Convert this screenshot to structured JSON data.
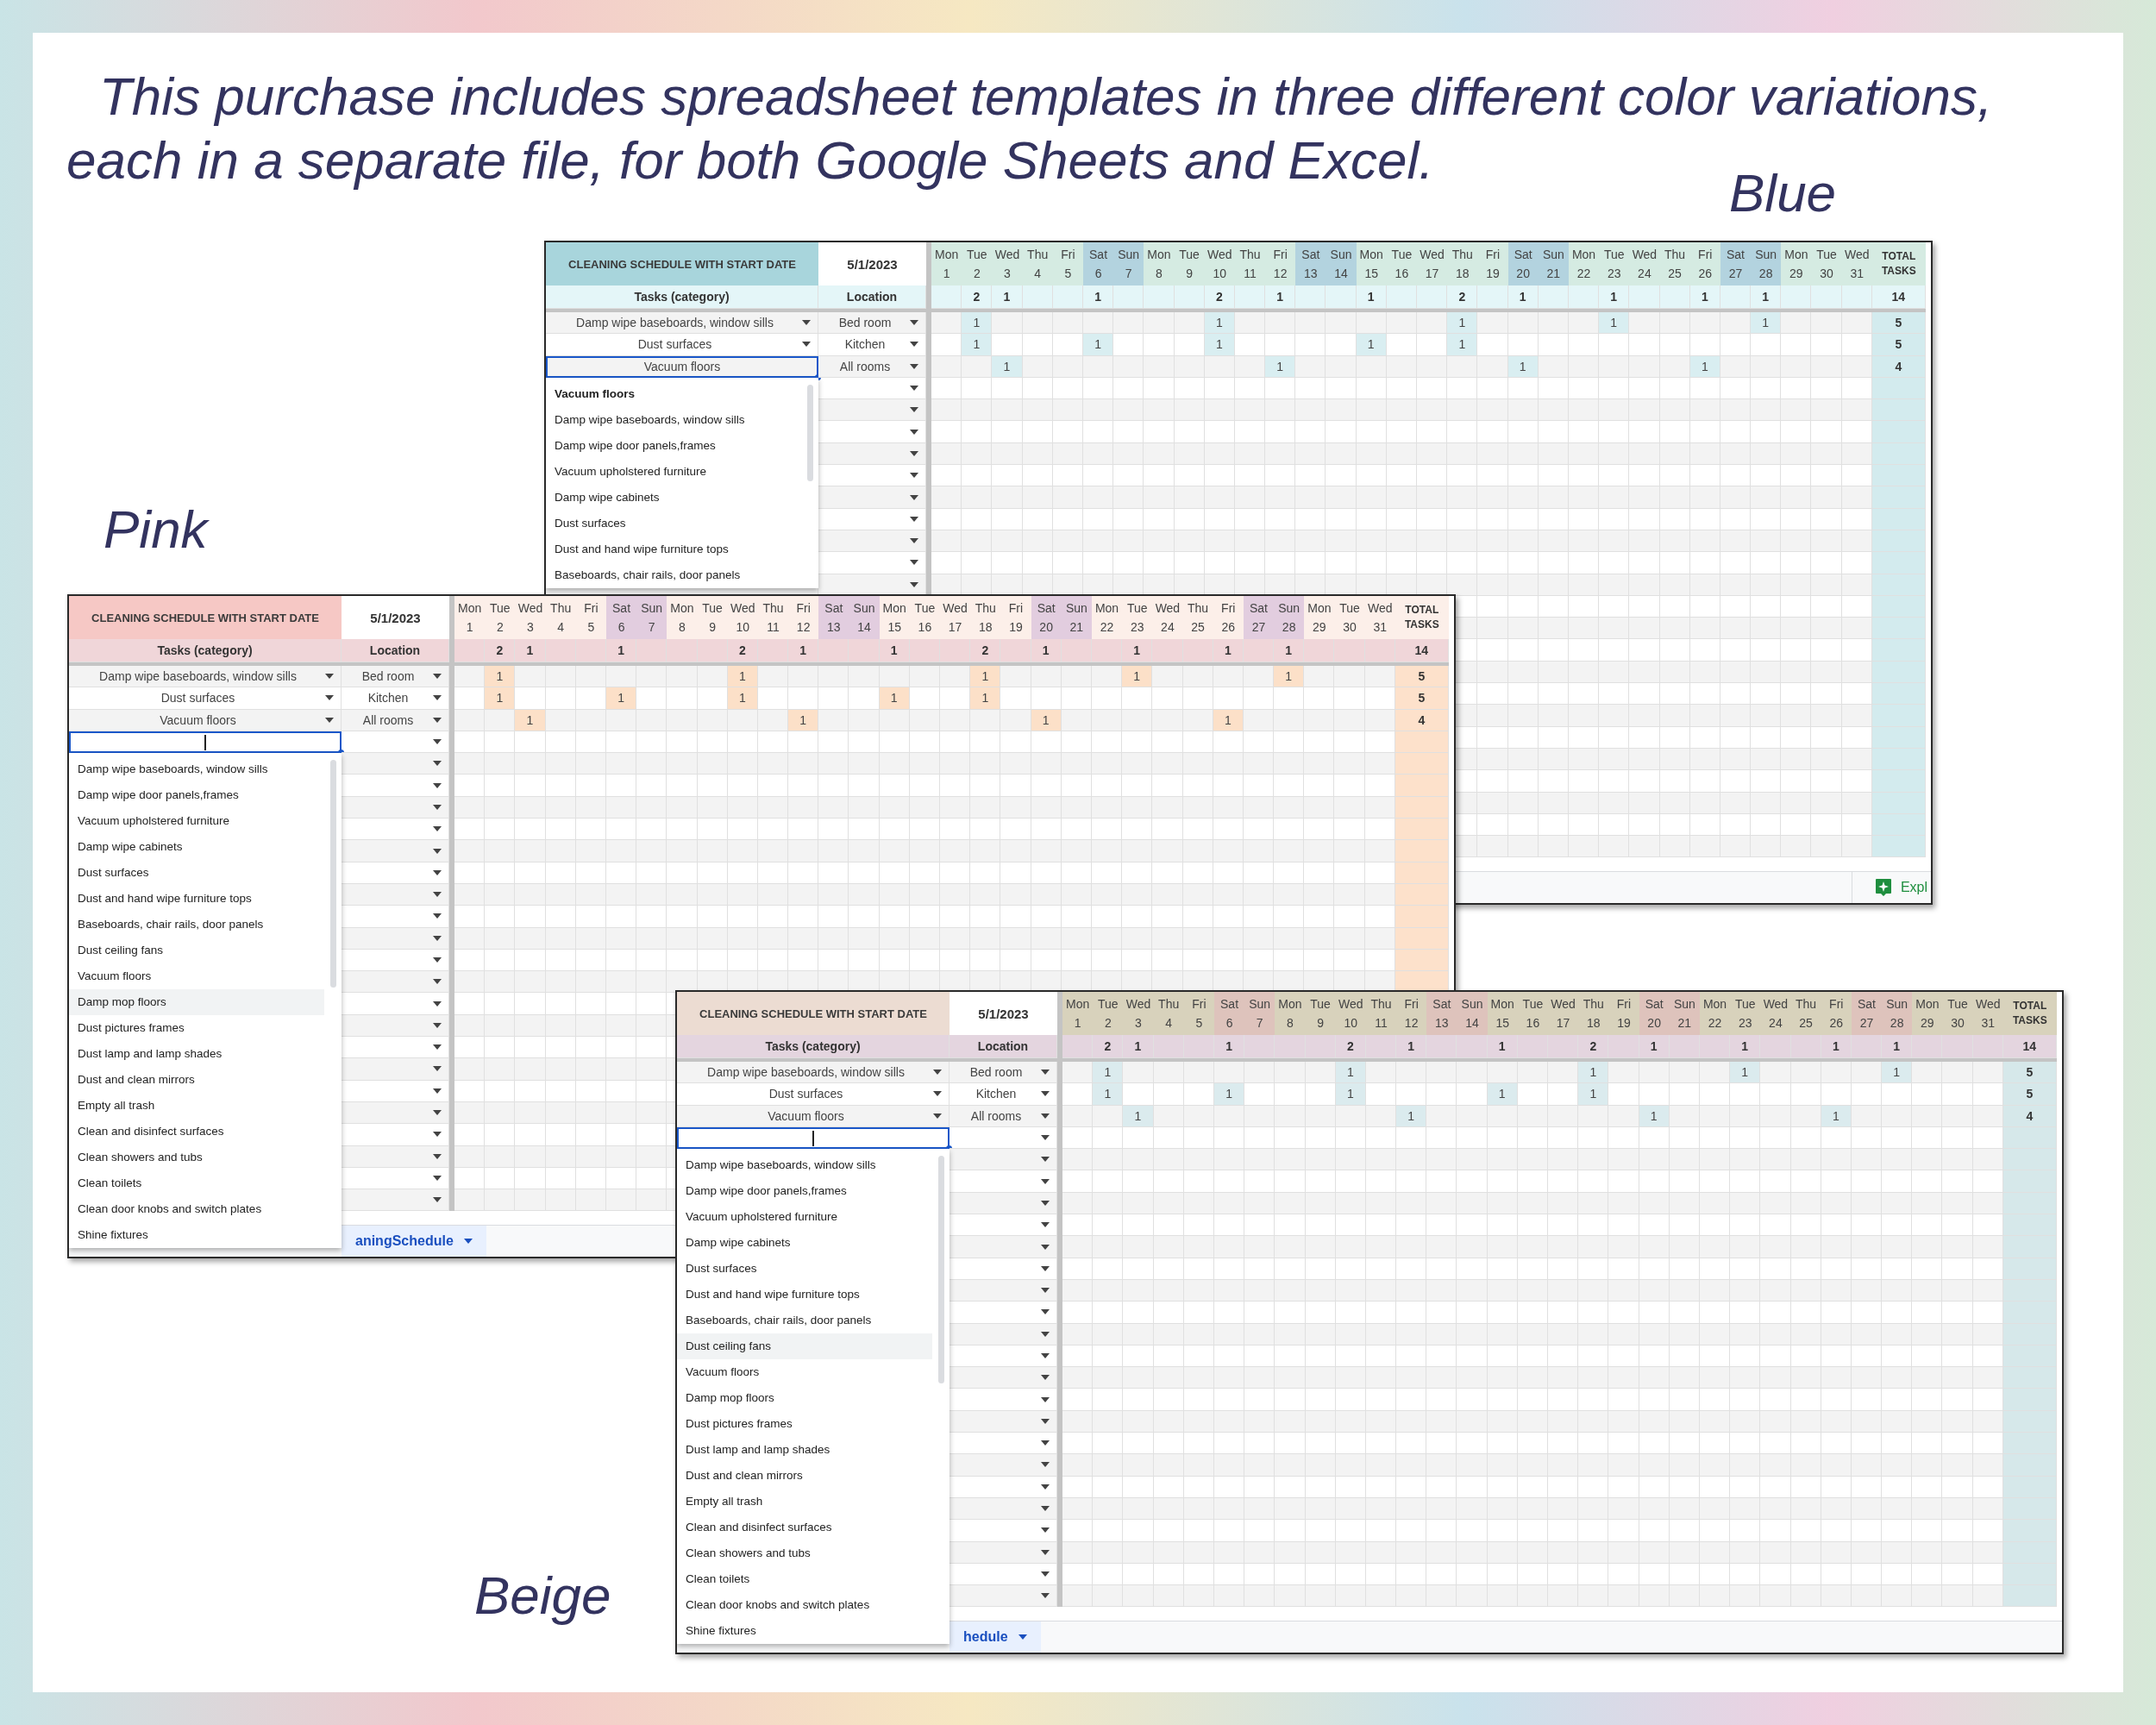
{
  "headline": "This purchase includes spreadsheet templates in three different color variations,\neach in a separate file, for both Google Sheets and Excel.",
  "sheets": [
    {
      "kind": "blue",
      "label": "Blue",
      "title": "CLEANING SCHEDULE WITH START DATE",
      "start_date": "5/1/2023",
      "task_header": "Tasks (category)",
      "location_header": "Location",
      "total_header": "TOTAL TASKS",
      "grand_total": "14",
      "days": [
        {
          "dow": "Mon",
          "date": "1",
          "weekend": false
        },
        {
          "dow": "Tue",
          "date": "2",
          "weekend": false,
          "total": "2"
        },
        {
          "dow": "Wed",
          "date": "3",
          "weekend": false,
          "total": "1"
        },
        {
          "dow": "Thu",
          "date": "4",
          "weekend": false
        },
        {
          "dow": "Fri",
          "date": "5",
          "weekend": false
        },
        {
          "dow": "Sat",
          "date": "6",
          "weekend": true,
          "total": "1"
        },
        {
          "dow": "Sun",
          "date": "7",
          "weekend": true
        },
        {
          "dow": "Mon",
          "date": "8",
          "weekend": false
        },
        {
          "dow": "Tue",
          "date": "9",
          "weekend": false
        },
        {
          "dow": "Wed",
          "date": "10",
          "weekend": false,
          "total": "2"
        },
        {
          "dow": "Thu",
          "date": "11",
          "weekend": false
        },
        {
          "dow": "Fri",
          "date": "12",
          "weekend": false,
          "total": "1"
        },
        {
          "dow": "Sat",
          "date": "13",
          "weekend": true
        },
        {
          "dow": "Sun",
          "date": "14",
          "weekend": true
        },
        {
          "dow": "Mon",
          "date": "15",
          "weekend": false,
          "total": "1"
        },
        {
          "dow": "Tue",
          "date": "16",
          "weekend": false
        },
        {
          "dow": "Wed",
          "date": "17",
          "weekend": false
        },
        {
          "dow": "Thu",
          "date": "18",
          "weekend": false,
          "total": "2"
        },
        {
          "dow": "Fri",
          "date": "19",
          "weekend": false
        },
        {
          "dow": "Sat",
          "date": "20",
          "weekend": true,
          "total": "1"
        },
        {
          "dow": "Sun",
          "date": "21",
          "weekend": true
        },
        {
          "dow": "Mon",
          "date": "22",
          "weekend": false
        },
        {
          "dow": "Tue",
          "date": "23",
          "weekend": false,
          "total": "1"
        },
        {
          "dow": "Wed",
          "date": "24",
          "weekend": false
        },
        {
          "dow": "Thu",
          "date": "25",
          "weekend": false
        },
        {
          "dow": "Fri",
          "date": "26",
          "weekend": false,
          "total": "1"
        },
        {
          "dow": "Sat",
          "date": "27",
          "weekend": true
        },
        {
          "dow": "Sun",
          "date": "28",
          "weekend": true,
          "total": "1"
        },
        {
          "dow": "Mon",
          "date": "29",
          "weekend": false
        },
        {
          "dow": "Tue",
          "date": "30",
          "weekend": false
        },
        {
          "dow": "Wed",
          "date": "31",
          "weekend": false
        }
      ],
      "rows": [
        {
          "task": "Damp wipe baseboards, window sills",
          "location": "Bed room",
          "total": "5",
          "active": false,
          "cells": [
            null,
            "1",
            null,
            null,
            null,
            null,
            null,
            null,
            null,
            "1",
            null,
            null,
            null,
            null,
            null,
            null,
            null,
            "1",
            null,
            null,
            null,
            null,
            "1",
            null,
            null,
            null,
            null,
            "1",
            null,
            null,
            null
          ]
        },
        {
          "task": "Dust surfaces",
          "location": "Kitchen",
          "total": "5",
          "active": false,
          "cells": [
            null,
            "1",
            null,
            null,
            null,
            "1",
            null,
            null,
            null,
            "1",
            null,
            null,
            null,
            null,
            "1",
            null,
            null,
            "1",
            null,
            null,
            null,
            null,
            null,
            null,
            null,
            null,
            null,
            null,
            null,
            null,
            null
          ]
        },
        {
          "task": "Vacuum floors",
          "location": "All rooms",
          "total": "4",
          "active": true,
          "cells": [
            null,
            null,
            "1",
            null,
            null,
            null,
            null,
            null,
            null,
            null,
            null,
            "1",
            null,
            null,
            null,
            null,
            null,
            null,
            null,
            "1",
            null,
            null,
            null,
            null,
            null,
            "1",
            null,
            null,
            null,
            null,
            null
          ]
        }
      ],
      "dropdown": {
        "items": [
          {
            "text": "Vacuum floors",
            "selected": true,
            "hovered": false
          },
          {
            "text": "Damp wipe baseboards, window sills",
            "selected": false,
            "hovered": false
          },
          {
            "text": "Damp wipe door panels,frames",
            "selected": false,
            "hovered": false
          },
          {
            "text": "Vacuum upholstered furniture",
            "selected": false,
            "hovered": false
          },
          {
            "text": "Damp wipe cabinets",
            "selected": false,
            "hovered": false
          },
          {
            "text": "Dust surfaces",
            "selected": false,
            "hovered": false
          },
          {
            "text": "Dust and hand wipe furniture tops",
            "selected": false,
            "hovered": false
          },
          {
            "text": "Baseboards, chair rails, door panels",
            "selected": false,
            "hovered": false
          }
        ]
      },
      "explore_button": "Expl"
    },
    {
      "kind": "pink",
      "label": "Pink",
      "title": "CLEANING SCHEDULE WITH START DATE",
      "start_date": "5/1/2023",
      "task_header": "Tasks (category)",
      "location_header": "Location",
      "total_header": "TOTAL TASKS",
      "grand_total": "14",
      "days": [
        {
          "dow": "Mon",
          "date": "1",
          "weekend": false
        },
        {
          "dow": "Tue",
          "date": "2",
          "weekend": false,
          "total": "2"
        },
        {
          "dow": "Wed",
          "date": "3",
          "weekend": false,
          "total": "1"
        },
        {
          "dow": "Thu",
          "date": "4",
          "weekend": false
        },
        {
          "dow": "Fri",
          "date": "5",
          "weekend": false
        },
        {
          "dow": "Sat",
          "date": "6",
          "weekend": true,
          "total": "1"
        },
        {
          "dow": "Sun",
          "date": "7",
          "weekend": true
        },
        {
          "dow": "Mon",
          "date": "8",
          "weekend": false
        },
        {
          "dow": "Tue",
          "date": "9",
          "weekend": false
        },
        {
          "dow": "Wed",
          "date": "10",
          "weekend": false,
          "total": "2"
        },
        {
          "dow": "Thu",
          "date": "11",
          "weekend": false
        },
        {
          "dow": "Fri",
          "date": "12",
          "weekend": false,
          "total": "1"
        },
        {
          "dow": "Sat",
          "date": "13",
          "weekend": true
        },
        {
          "dow": "Sun",
          "date": "14",
          "weekend": true
        },
        {
          "dow": "Mon",
          "date": "15",
          "weekend": false,
          "total": "1"
        },
        {
          "dow": "Tue",
          "date": "16",
          "weekend": false
        },
        {
          "dow": "Wed",
          "date": "17",
          "weekend": false
        },
        {
          "dow": "Thu",
          "date": "18",
          "weekend": false,
          "total": "2"
        },
        {
          "dow": "Fri",
          "date": "19",
          "weekend": false
        },
        {
          "dow": "Sat",
          "date": "20",
          "weekend": true,
          "total": "1"
        },
        {
          "dow": "Sun",
          "date": "21",
          "weekend": true
        },
        {
          "dow": "Mon",
          "date": "22",
          "weekend": false
        },
        {
          "dow": "Tue",
          "date": "23",
          "weekend": false,
          "total": "1"
        },
        {
          "dow": "Wed",
          "date": "24",
          "weekend": false
        },
        {
          "dow": "Thu",
          "date": "25",
          "weekend": false
        },
        {
          "dow": "Fri",
          "date": "26",
          "weekend": false,
          "total": "1"
        },
        {
          "dow": "Sat",
          "date": "27",
          "weekend": true
        },
        {
          "dow": "Sun",
          "date": "28",
          "weekend": true,
          "total": "1"
        },
        {
          "dow": "Mon",
          "date": "29",
          "weekend": false
        },
        {
          "dow": "Tue",
          "date": "30",
          "weekend": false
        },
        {
          "dow": "Wed",
          "date": "31",
          "weekend": false
        }
      ],
      "rows": [
        {
          "task": "Damp wipe baseboards, window sills",
          "location": "Bed room",
          "total": "5",
          "active": false,
          "cells": [
            null,
            "1",
            null,
            null,
            null,
            null,
            null,
            null,
            null,
            "1",
            null,
            null,
            null,
            null,
            null,
            null,
            null,
            "1",
            null,
            null,
            null,
            null,
            "1",
            null,
            null,
            null,
            null,
            "1",
            null,
            null,
            null
          ]
        },
        {
          "task": "Dust surfaces",
          "location": "Kitchen",
          "total": "5",
          "active": false,
          "cells": [
            null,
            "1",
            null,
            null,
            null,
            "1",
            null,
            null,
            null,
            "1",
            null,
            null,
            null,
            null,
            "1",
            null,
            null,
            "1",
            null,
            null,
            null,
            null,
            null,
            null,
            null,
            null,
            null,
            null,
            null,
            null,
            null
          ]
        },
        {
          "task": "Vacuum floors",
          "location": "All rooms",
          "total": "4",
          "active": false,
          "cells": [
            null,
            null,
            "1",
            null,
            null,
            null,
            null,
            null,
            null,
            null,
            null,
            "1",
            null,
            null,
            null,
            null,
            null,
            null,
            null,
            "1",
            null,
            null,
            null,
            null,
            null,
            "1",
            null,
            null,
            null,
            null,
            null
          ]
        },
        {
          "active": true
        }
      ],
      "dropdown": {
        "items": [
          {
            "text": "Damp wipe baseboards, window sills",
            "selected": false,
            "hovered": false
          },
          {
            "text": "Damp wipe door panels,frames",
            "selected": false,
            "hovered": false
          },
          {
            "text": "Vacuum upholstered furniture",
            "selected": false,
            "hovered": false
          },
          {
            "text": "Damp wipe cabinets",
            "selected": false,
            "hovered": false
          },
          {
            "text": "Dust surfaces",
            "selected": false,
            "hovered": false
          },
          {
            "text": "Dust and hand wipe furniture tops",
            "selected": false,
            "hovered": false
          },
          {
            "text": "Baseboards, chair rails, door panels",
            "selected": false,
            "hovered": false
          },
          {
            "text": "Dust ceiling fans",
            "selected": false,
            "hovered": false
          },
          {
            "text": "Vacuum floors",
            "selected": false,
            "hovered": false
          },
          {
            "text": "Damp mop floors",
            "selected": false,
            "hovered": true
          },
          {
            "text": "Dust pictures frames",
            "selected": false,
            "hovered": false
          },
          {
            "text": "Dust lamp and lamp shades",
            "selected": false,
            "hovered": false
          },
          {
            "text": "Dust and clean mirrors",
            "selected": false,
            "hovered": false
          },
          {
            "text": "Empty all trash",
            "selected": false,
            "hovered": false
          },
          {
            "text": "Clean and disinfect surfaces",
            "selected": false,
            "hovered": false
          },
          {
            "text": "Clean showers and tubs",
            "selected": false,
            "hovered": false
          },
          {
            "text": "Clean toilets",
            "selected": false,
            "hovered": false
          },
          {
            "text": "Clean door knobs and switch plates",
            "selected": false,
            "hovered": false
          },
          {
            "text": "Shine fixtures",
            "selected": false,
            "hovered": false
          }
        ]
      },
      "sheet_tab": {
        "label": "aningSchedule",
        "selected": true
      }
    },
    {
      "kind": "beige",
      "label": "Beige",
      "title": "CLEANING SCHEDULE WITH START DATE",
      "start_date": "5/1/2023",
      "task_header": "Tasks (category)",
      "location_header": "Location",
      "total_header": "TOTAL TASKS",
      "grand_total": "14",
      "days": [
        {
          "dow": "Mon",
          "date": "1",
          "weekend": false
        },
        {
          "dow": "Tue",
          "date": "2",
          "weekend": false,
          "total": "2"
        },
        {
          "dow": "Wed",
          "date": "3",
          "weekend": false,
          "total": "1"
        },
        {
          "dow": "Thu",
          "date": "4",
          "weekend": false
        },
        {
          "dow": "Fri",
          "date": "5",
          "weekend": false
        },
        {
          "dow": "Sat",
          "date": "6",
          "weekend": true,
          "total": "1"
        },
        {
          "dow": "Sun",
          "date": "7",
          "weekend": true
        },
        {
          "dow": "Mon",
          "date": "8",
          "weekend": false
        },
        {
          "dow": "Tue",
          "date": "9",
          "weekend": false
        },
        {
          "dow": "Wed",
          "date": "10",
          "weekend": false,
          "total": "2"
        },
        {
          "dow": "Thu",
          "date": "11",
          "weekend": false
        },
        {
          "dow": "Fri",
          "date": "12",
          "weekend": false,
          "total": "1"
        },
        {
          "dow": "Sat",
          "date": "13",
          "weekend": true
        },
        {
          "dow": "Sun",
          "date": "14",
          "weekend": true
        },
        {
          "dow": "Mon",
          "date": "15",
          "weekend": false,
          "total": "1"
        },
        {
          "dow": "Tue",
          "date": "16",
          "weekend": false
        },
        {
          "dow": "Wed",
          "date": "17",
          "weekend": false
        },
        {
          "dow": "Thu",
          "date": "18",
          "weekend": false,
          "total": "2"
        },
        {
          "dow": "Fri",
          "date": "19",
          "weekend": false
        },
        {
          "dow": "Sat",
          "date": "20",
          "weekend": true,
          "total": "1"
        },
        {
          "dow": "Sun",
          "date": "21",
          "weekend": true
        },
        {
          "dow": "Mon",
          "date": "22",
          "weekend": false
        },
        {
          "dow": "Tue",
          "date": "23",
          "weekend": false,
          "total": "1"
        },
        {
          "dow": "Wed",
          "date": "24",
          "weekend": false
        },
        {
          "dow": "Thu",
          "date": "25",
          "weekend": false
        },
        {
          "dow": "Fri",
          "date": "26",
          "weekend": false,
          "total": "1"
        },
        {
          "dow": "Sat",
          "date": "27",
          "weekend": true
        },
        {
          "dow": "Sun",
          "date": "28",
          "weekend": true,
          "total": "1"
        },
        {
          "dow": "Mon",
          "date": "29",
          "weekend": false
        },
        {
          "dow": "Tue",
          "date": "30",
          "weekend": false
        },
        {
          "dow": "Wed",
          "date": "31",
          "weekend": false
        }
      ],
      "rows": [
        {
          "task": "Damp wipe baseboards, window sills",
          "location": "Bed room",
          "total": "5",
          "active": false,
          "cells": [
            null,
            "1",
            null,
            null,
            null,
            null,
            null,
            null,
            null,
            "1",
            null,
            null,
            null,
            null,
            null,
            null,
            null,
            "1",
            null,
            null,
            null,
            null,
            "1",
            null,
            null,
            null,
            null,
            "1",
            null,
            null,
            null
          ]
        },
        {
          "task": "Dust surfaces",
          "location": "Kitchen",
          "total": "5",
          "active": false,
          "cells": [
            null,
            "1",
            null,
            null,
            null,
            "1",
            null,
            null,
            null,
            "1",
            null,
            null,
            null,
            null,
            "1",
            null,
            null,
            "1",
            null,
            null,
            null,
            null,
            null,
            null,
            null,
            null,
            null,
            null,
            null,
            null,
            null
          ]
        },
        {
          "task": "Vacuum floors",
          "location": "All rooms",
          "total": "4",
          "active": false,
          "cells": [
            null,
            null,
            "1",
            null,
            null,
            null,
            null,
            null,
            null,
            null,
            null,
            "1",
            null,
            null,
            null,
            null,
            null,
            null,
            null,
            "1",
            null,
            null,
            null,
            null,
            null,
            "1",
            null,
            null,
            null,
            null,
            null
          ]
        },
        {
          "active": true
        }
      ],
      "dropdown": {
        "items": [
          {
            "text": "Damp wipe baseboards, window sills",
            "selected": false,
            "hovered": false
          },
          {
            "text": "Damp wipe door panels,frames",
            "selected": false,
            "hovered": false
          },
          {
            "text": "Vacuum upholstered furniture",
            "selected": false,
            "hovered": false
          },
          {
            "text": "Damp wipe cabinets",
            "selected": false,
            "hovered": false
          },
          {
            "text": "Dust surfaces",
            "selected": false,
            "hovered": false
          },
          {
            "text": "Dust and hand wipe furniture tops",
            "selected": false,
            "hovered": false
          },
          {
            "text": "Baseboards, chair rails, door panels",
            "selected": false,
            "hovered": false
          },
          {
            "text": "Dust ceiling fans",
            "selected": false,
            "hovered": true
          },
          {
            "text": "Vacuum floors",
            "selected": false,
            "hovered": false
          },
          {
            "text": "Damp mop floors",
            "selected": false,
            "hovered": false
          },
          {
            "text": "Dust pictures frames",
            "selected": false,
            "hovered": false
          },
          {
            "text": "Dust lamp and lamp shades",
            "selected": false,
            "hovered": false
          },
          {
            "text": "Dust and clean mirrors",
            "selected": false,
            "hovered": false
          },
          {
            "text": "Empty all trash",
            "selected": false,
            "hovered": false
          },
          {
            "text": "Clean and disinfect surfaces",
            "selected": false,
            "hovered": false
          },
          {
            "text": "Clean showers and tubs",
            "selected": false,
            "hovered": false
          },
          {
            "text": "Clean toilets",
            "selected": false,
            "hovered": false
          },
          {
            "text": "Clean door knobs and switch plates",
            "selected": false,
            "hovered": false
          },
          {
            "text": "Shine fixtures",
            "selected": false,
            "hovered": false
          }
        ]
      },
      "sheet_tab": {
        "label": "hedule",
        "selected": true
      }
    }
  ]
}
